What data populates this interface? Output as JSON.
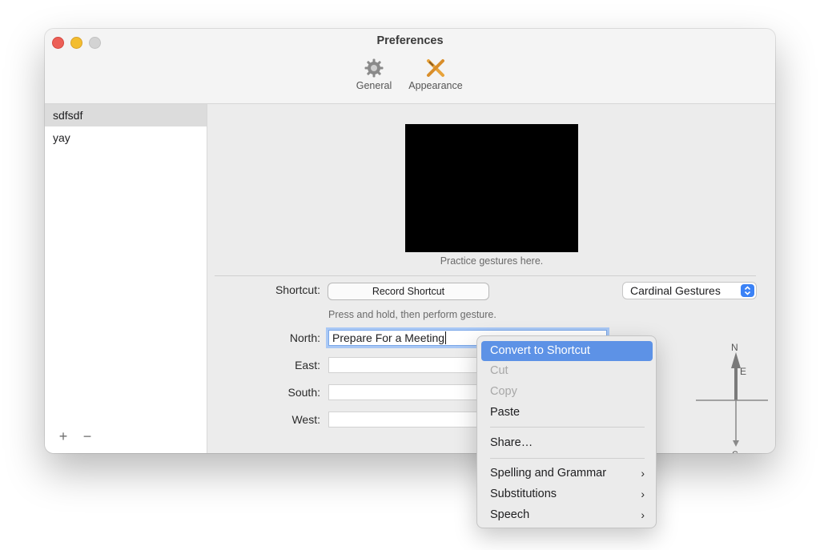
{
  "window": {
    "title": "Preferences"
  },
  "toolbar": {
    "general_label": "General",
    "appearance_label": "Appearance"
  },
  "sidebar": {
    "items": [
      {
        "label": "sdfsdf",
        "selected": true
      },
      {
        "label": "yay",
        "selected": false
      }
    ],
    "add_symbol": "+",
    "remove_symbol": "−"
  },
  "gesture": {
    "practice_caption": "Practice gestures here.",
    "shortcut_label": "Shortcut:",
    "record_button": "Record Shortcut",
    "hint": "Press and hold, then perform gesture.",
    "type_popup": "Cardinal Gestures",
    "directions": {
      "north": {
        "label": "North:",
        "value": "Prepare For a Meeting"
      },
      "east": {
        "label": "East:",
        "value": ""
      },
      "south": {
        "label": "South:",
        "value": ""
      },
      "west": {
        "label": "West:",
        "value": ""
      }
    },
    "compass": {
      "n": "N",
      "e": "E",
      "s": "S"
    }
  },
  "context_menu": {
    "items": [
      {
        "label": "Convert to Shortcut",
        "state": "highlighted"
      },
      {
        "label": "Cut",
        "state": "disabled"
      },
      {
        "label": "Copy",
        "state": "disabled"
      },
      {
        "label": "Paste",
        "state": "enabled"
      },
      {
        "label": "Share…",
        "state": "enabled"
      },
      {
        "label": "Spelling and Grammar",
        "state": "submenu"
      },
      {
        "label": "Substitutions",
        "state": "submenu"
      },
      {
        "label": "Speech",
        "state": "submenu"
      }
    ],
    "submenu_glyph": "›"
  },
  "colors": {
    "accent": "#3b82f6",
    "menu_highlight": "#5d92e6",
    "close": "#ec5f57",
    "minimize": "#f3bd2f"
  }
}
